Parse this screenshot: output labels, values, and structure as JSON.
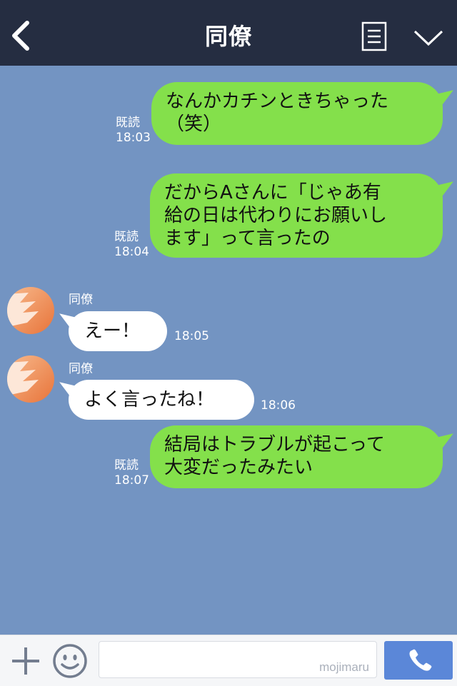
{
  "header": {
    "title": "同僚",
    "back_icon": "chevron-left-icon",
    "notes_icon": "notes-icon",
    "menu_icon": "chevron-down-icon"
  },
  "messages": [
    {
      "side": "out",
      "lines": [
        "なんかカチンときちゃった",
        "（笑）"
      ],
      "read": "既読",
      "time": "18:03"
    },
    {
      "side": "out",
      "lines": [
        "だからAさんに「じゃあ有",
        "給の日は代わりにお願いし",
        "ます」って言ったの"
      ],
      "read": "既読",
      "time": "18:04"
    },
    {
      "side": "in",
      "sender": "同僚",
      "lines": [
        "えー！"
      ],
      "time": "18:05"
    },
    {
      "side": "in",
      "sender": "同僚",
      "lines": [
        "よく言ったね！"
      ],
      "time": "18:06"
    },
    {
      "side": "out",
      "lines": [
        "結局はトラブルが起こって",
        "大変だったみたい"
      ],
      "read": "既読",
      "time": "18:07"
    }
  ],
  "footer": {
    "plus_icon": "plus-icon",
    "emoji_icon": "smiley-icon",
    "input_value": "",
    "watermark": "mojimaru",
    "call_icon": "phone-icon"
  },
  "colors": {
    "header_bg": "#252d41",
    "chat_bg": "#7394c2",
    "bubble_out": "#84e04b",
    "bubble_in": "#ffffff",
    "call_button": "#5b87d8"
  }
}
